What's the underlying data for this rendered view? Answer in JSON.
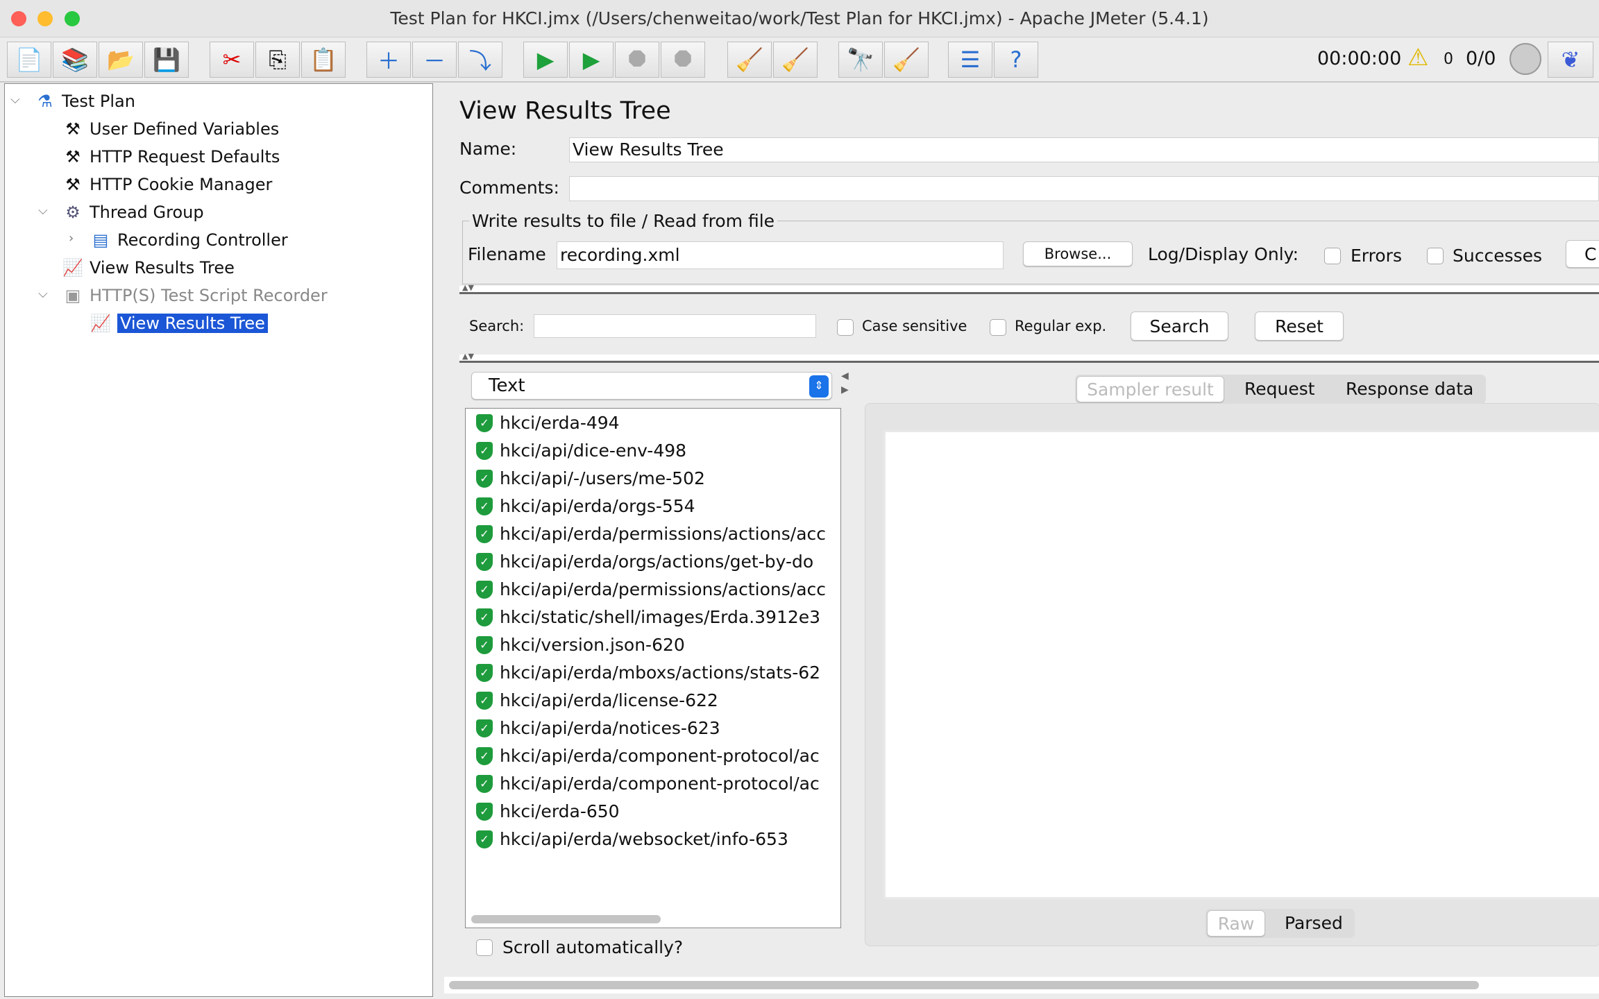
{
  "window": {
    "title": "Test Plan for HKCI.jmx (/Users/chenweitao/work/Test Plan for HKCI.jmx) - Apache JMeter (5.4.1)"
  },
  "toolbar": {
    "buttons": [
      "new-icon",
      "templates-icon",
      "open-icon",
      "save-icon",
      "cut-icon",
      "copy-icon",
      "paste-icon",
      "expand-icon",
      "collapse-icon",
      "toggle-icon",
      "start-icon",
      "start-no-pause-icon",
      "stop-icon",
      "shutdown-icon",
      "clear-icon",
      "clear-all-icon",
      "search-icon",
      "reset-search-icon",
      "function-helper-icon",
      "help-icon"
    ],
    "timer": "00:00:00",
    "warnings": "0",
    "threads": "0/0"
  },
  "tree": {
    "items": [
      {
        "label": "Test Plan",
        "icon": "flask-icon"
      },
      {
        "label": "User Defined Variables",
        "icon": "tools-icon"
      },
      {
        "label": "HTTP Request Defaults",
        "icon": "tools-icon"
      },
      {
        "label": "HTTP Cookie Manager",
        "icon": "tools-icon"
      },
      {
        "label": "Thread Group",
        "icon": "gear-icon"
      },
      {
        "label": "Recording Controller",
        "icon": "controller-icon"
      },
      {
        "label": "View Results Tree",
        "icon": "chart-icon"
      },
      {
        "label": "HTTP(S) Test Script Recorder",
        "icon": "recorder-icon"
      },
      {
        "label": "View Results Tree",
        "icon": "chart-icon",
        "selected": true
      }
    ]
  },
  "panel": {
    "heading": "View Results Tree",
    "name_label": "Name:",
    "name_value": "View Results Tree",
    "comments_label": "Comments:",
    "comments_value": "",
    "file_group": "Write results to file / Read from file",
    "filename_label": "Filename",
    "filename_value": "recording.xml",
    "browse": "Browse...",
    "log_display": "Log/Display Only:",
    "errors": "Errors",
    "successes": "Successes",
    "configure": "C"
  },
  "search": {
    "label": "Search:",
    "value": "",
    "case_sensitive": "Case sensitive",
    "regex": "Regular exp.",
    "search_button": "Search",
    "reset_button": "Reset"
  },
  "renderer": {
    "selected": "Text"
  },
  "results": [
    "hkci/erda-494",
    "hkci/api/dice-env-498",
    "hkci/api/-/users/me-502",
    "hkci/api/erda/orgs-554",
    "hkci/api/erda/permissions/actions/acc",
    "hkci/api/erda/orgs/actions/get-by-do",
    "hkci/api/erda/permissions/actions/acc",
    "hkci/static/shell/images/Erda.3912e3",
    "hkci/version.json-620",
    "hkci/api/erda/mboxs/actions/stats-62",
    "hkci/api/erda/license-622",
    "hkci/api/erda/notices-623",
    "hkci/api/erda/component-protocol/ac",
    "hkci/api/erda/component-protocol/ac",
    "hkci/erda-650",
    "hkci/api/erda/websocket/info-653"
  ],
  "tabs": [
    "Sampler result",
    "Request",
    "Response data"
  ],
  "view_tabs": [
    "Raw",
    "Parsed"
  ],
  "scroll_auto": "Scroll automatically?",
  "colors": {
    "selection": "#1b56d6",
    "success": "#1e9b3c",
    "accent": "#1a73e8"
  }
}
